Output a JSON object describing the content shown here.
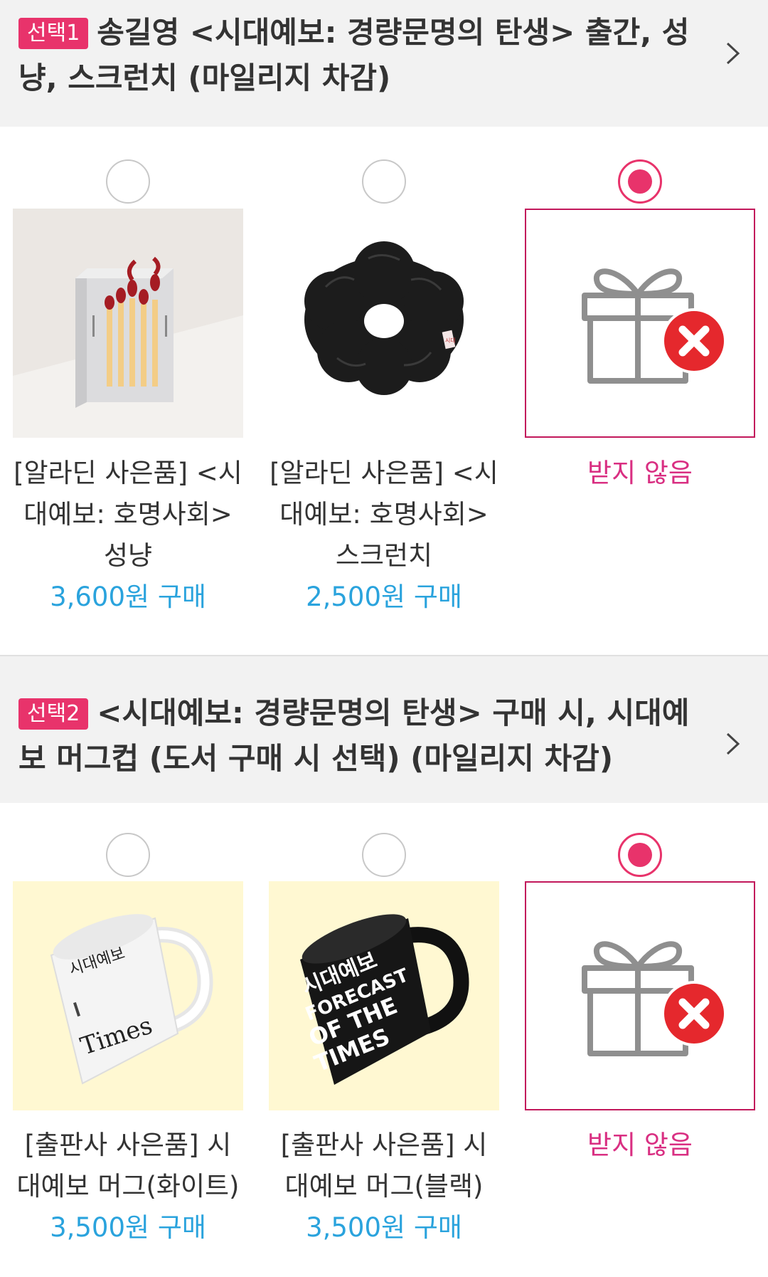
{
  "section1": {
    "badge": "선택1",
    "title": "송길영 <시대예보: 경량문명의 탄생> 출간, 성냥, 스크런치 (마일리지 차감)",
    "options": [
      {
        "name": "[알라딘 사은품] <시대예보: 호명사회> 성냥",
        "price": "3,600원 구매",
        "selected": false
      },
      {
        "name": "[알라딘 사은품] <시대예보: 호명사회> 스크런치",
        "price": "2,500원 구매",
        "selected": false
      },
      {
        "name": "받지 않음",
        "selected": true
      }
    ]
  },
  "section2": {
    "badge": "선택2",
    "title": "<시대예보: 경량문명의 탄생> 구매 시, 시대예보 머그컵 (도서 구매 시 선택) (마일리지 차감)",
    "options": [
      {
        "name": "[출판사 사은품] 시대예보 머그(화이트)",
        "price": "3,500원 구매",
        "selected": false,
        "mug_text": [
          "시대예보",
          "Times"
        ]
      },
      {
        "name": "[출판사 사은품] 시대예보 머그(블랙)",
        "price": "3,500원 구매",
        "selected": false,
        "mug_text": [
          "시대예보",
          "FORECAST",
          "OF THE",
          "TIMES"
        ]
      },
      {
        "name": "받지 않음",
        "selected": true
      }
    ]
  },
  "icons": {
    "chevron": "chevron-right-icon",
    "no_gift": "gift-cancel-icon"
  },
  "colors": {
    "accent": "#e8336b",
    "price": "#2aa3dd",
    "none_label": "#d92f82",
    "header_bg": "#f2f2f2"
  }
}
